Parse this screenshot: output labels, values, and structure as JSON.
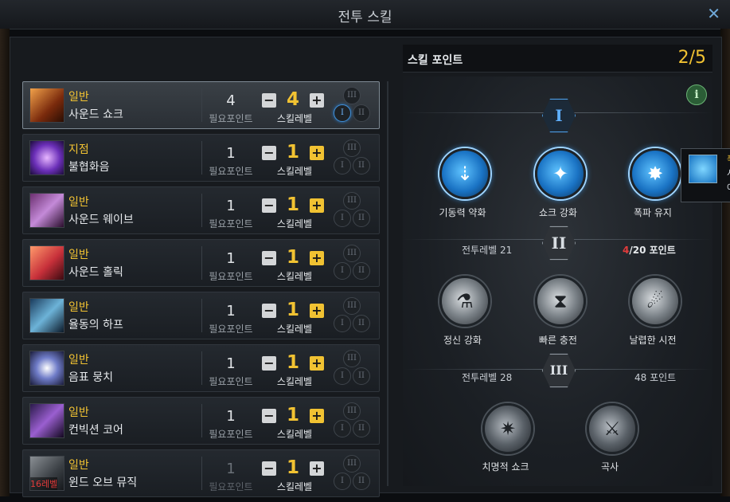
{
  "window": {
    "title": "전투 스킬",
    "close": "✕"
  },
  "skills": [
    {
      "grade": "일반",
      "name": "사운드 쇼크",
      "required_points": "4",
      "required_label": "필요포인트",
      "level": "4",
      "level_label": "스킬레벨",
      "selected": true,
      "active_tier": "I",
      "gradient": "linear-gradient(135deg,#f2a24a,#7a2a0c 60%,#2a0e04)"
    },
    {
      "grade": "지점",
      "name": "불협화음",
      "required_points": "1",
      "required_label": "필요포인트",
      "level": "1",
      "level_label": "스킬레벨",
      "selected": false,
      "gradient": "radial-gradient(circle,#e7b6ff,#6b2fb8 55%,#1c0c3a)"
    },
    {
      "grade": "일반",
      "name": "사운드 웨이브",
      "required_points": "1",
      "required_label": "필요포인트",
      "level": "1",
      "level_label": "스킬레벨",
      "selected": false,
      "gradient": "linear-gradient(135deg,#6b2f6f,#c48ad8 50%,#2a0d2c)"
    },
    {
      "grade": "일반",
      "name": "사운드 홀릭",
      "required_points": "1",
      "required_label": "필요포인트",
      "level": "1",
      "level_label": "스킬레벨",
      "selected": false,
      "gradient": "linear-gradient(135deg,#ff9a6b,#c7303a 55%,#3a0a10)"
    },
    {
      "grade": "일반",
      "name": "율동의 하프",
      "required_points": "1",
      "required_label": "필요포인트",
      "level": "1",
      "level_label": "스킬레벨",
      "selected": false,
      "gradient": "linear-gradient(135deg,#1a3b5c,#6db3d8 50%,#0c1a2a)"
    },
    {
      "grade": "일반",
      "name": "음표 뭉치",
      "required_points": "1",
      "required_label": "필요포인트",
      "level": "1",
      "level_label": "스킬레벨",
      "selected": false,
      "gradient": "radial-gradient(circle,#ffffff,#6f7cc8 45%,#1a1c3a)"
    },
    {
      "grade": "일반",
      "name": "컨빅션 코어",
      "required_points": "1",
      "required_label": "필요포인트",
      "level": "1",
      "level_label": "스킬레벨",
      "selected": false,
      "gradient": "linear-gradient(135deg,#2a1a4a,#9a5fd0 50%,#12081f)"
    },
    {
      "grade": "일반",
      "name": "윈드 오브 뮤직",
      "required_points": "1",
      "required_label": "필요포인트",
      "level": "1",
      "level_label": "스킬레벨",
      "selected": false,
      "dim": true,
      "lock_text": "16레벨",
      "gradient": "linear-gradient(135deg,#8a8f94,#3a3f44 60%,#15181c)"
    }
  ],
  "tier_labels": {
    "t1": "I",
    "t2": "II",
    "t3": "III"
  },
  "buttons": {
    "minus": "−",
    "plus": "+"
  },
  "points_panel": {
    "label": "스킬 포인트",
    "value": "2/5"
  },
  "info_icon": "i",
  "tree": {
    "tier1": {
      "label": "I",
      "nodes": [
        {
          "name": "기동력 약화",
          "glyph": "⇣"
        },
        {
          "name": "쇼크 강화",
          "glyph": "✦"
        },
        {
          "name": "폭파 유지",
          "glyph": "✸"
        }
      ]
    },
    "tier2": {
      "label": "II",
      "req_left": "전투레벨 21",
      "req_right_cur": "4",
      "req_right_rest": "/20 포인트",
      "nodes": [
        {
          "name": "정신 강화",
          "glyph": "⚗"
        },
        {
          "name": "빠른 충전",
          "glyph": "⧗"
        },
        {
          "name": "날렵한 시전",
          "glyph": "☄"
        }
      ]
    },
    "tier3": {
      "label": "III",
      "req_left": "전투레벨 28",
      "req_right": "48 포인트",
      "nodes": [
        {
          "name": "치명적 쇼크",
          "glyph": "✷"
        },
        {
          "name": "곡사",
          "glyph": "⚔"
        }
      ]
    }
  },
  "tooltip": {
    "line1": "폭",
    "line2": "시",
    "line3": "여"
  },
  "colors": {
    "gold": "#f1c232",
    "accent_blue": "#4c9be2",
    "red": "#e23b3b"
  }
}
